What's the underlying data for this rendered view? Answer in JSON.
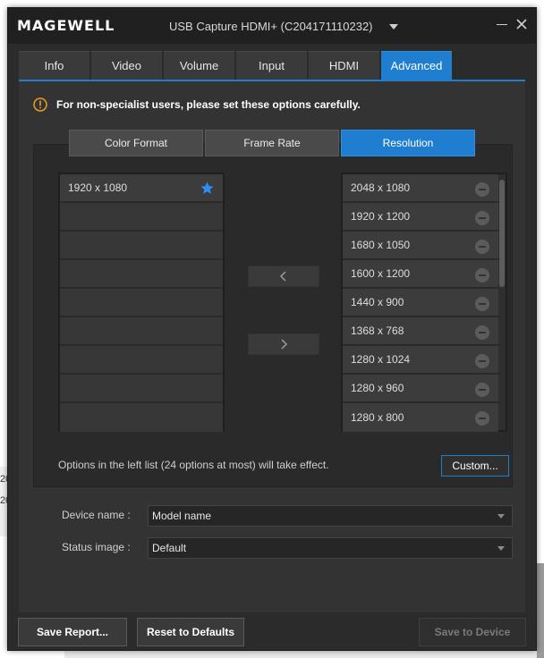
{
  "window": {
    "app_logo_text": "MAGEWELL",
    "device_name": "USB Capture HDMI+ (C204171110232)"
  },
  "tabs": [
    {
      "label": "Info",
      "active": false
    },
    {
      "label": "Video",
      "active": false
    },
    {
      "label": "Volume",
      "active": false
    },
    {
      "label": "Input",
      "active": false
    },
    {
      "label": "HDMI",
      "active": false
    },
    {
      "label": "Advanced",
      "active": true
    }
  ],
  "warning_text": "For non-specialist users, please set these options carefully.",
  "subtabs": [
    {
      "label": "Color Format",
      "active": false
    },
    {
      "label": "Frame Rate",
      "active": false
    },
    {
      "label": "Resolution",
      "active": true
    }
  ],
  "left_list": {
    "items": [
      "1920 x 1080",
      "",
      "",
      "",
      "",
      "",
      "",
      "",
      ""
    ],
    "starred": "1920 x 1080"
  },
  "right_list": {
    "items": [
      "2048 x 1080",
      "1920 x 1200",
      "1680 x 1050",
      "1600 x 1200",
      "1440 x 900",
      "1368 x 768",
      "1280 x 1024",
      "1280 x 960",
      "1280 x 800"
    ]
  },
  "hint_text": "Options in the left list (24 options at most) will take effect.",
  "custom_button": "Custom...",
  "device_name_field": {
    "label": "Device name :",
    "value": "Model name"
  },
  "status_image_field": {
    "label": "Status image :",
    "value": "Default"
  },
  "footer": {
    "save_report": "Save Report...",
    "reset_defaults": "Reset to Defaults",
    "save_to_device": "Save to Device"
  },
  "background_fragments": [
    "20",
    "20"
  ],
  "colors": {
    "accent": "#1f7ecf",
    "warning": "#e8a020",
    "star": "#2a8ff0"
  },
  "icons": {
    "logo": "magewell-logo",
    "minimize": "minimize-icon",
    "close": "close-icon",
    "warning": "warning-icon",
    "star": "star-icon",
    "remove": "minus-circle-icon",
    "move_left": "chevron-left-icon",
    "move_right": "chevron-right-icon",
    "dropdown": "chevron-down-icon"
  }
}
